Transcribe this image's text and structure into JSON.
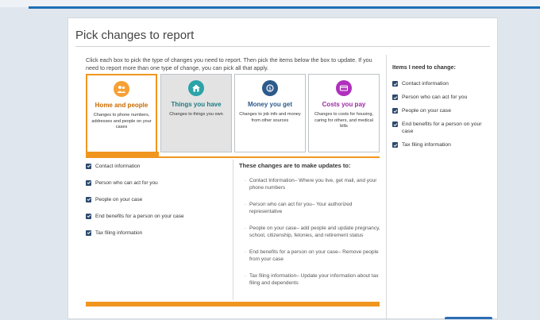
{
  "page": {
    "title": "Pick changes to report",
    "intro": "Click each box to pick the type of changes you need to report. Then pick the items below the box to update. If you need to report more than one type of change, you can pick all that apply."
  },
  "colors": {
    "accent": "#f0961f",
    "primary": "#1f6fb5",
    "checkbox": "#2d4a6e",
    "tile_home_icon": "#f7a035",
    "tile_things_icon": "#2ba3a8",
    "tile_money_icon": "#2d5a8c",
    "tile_costs_icon": "#b02fbd"
  },
  "tiles": [
    {
      "label": "Home and people",
      "desc": "Changes to phone numbers, addresses and people on your cases",
      "icon": "people-icon",
      "selected": true
    },
    {
      "label": "Things you have",
      "desc": "Changes to things you own",
      "icon": "house-icon",
      "selected": false
    },
    {
      "label": "Money you get",
      "desc": "Changes to job info and money from other sources",
      "icon": "money-icon",
      "selected": false
    },
    {
      "label": "Costs you pay",
      "desc": "Changes to costs for housing, caring for others, and medical bills",
      "icon": "card-icon",
      "selected": false
    }
  ],
  "options": [
    {
      "label": "Contact information",
      "checked": true
    },
    {
      "label": "Person who can act for you",
      "checked": true
    },
    {
      "label": "People on your case",
      "checked": true
    },
    {
      "label": "End benefits for a person on your case",
      "checked": true
    },
    {
      "label": "Tax filing information",
      "checked": true
    }
  ],
  "changes": {
    "heading": "These changes are to make updates to:",
    "items": [
      "Contact Information– Where you live, get mail, and your phone numbers",
      "Person who can act for you– Your authorized representative",
      "People on your case– add people and update pregnancy, school, citizenship, felonies, and retirement status",
      "End benefits for a person on your case– Remove people from your case",
      "Tax filing information– Update your information about tax filing and dependents"
    ]
  },
  "summary": {
    "heading": "Items I need to change:",
    "items": [
      "Contact information",
      "Person who can act for you",
      "People on your case",
      "End benefits for a person on your case",
      "Tax filing information"
    ]
  }
}
